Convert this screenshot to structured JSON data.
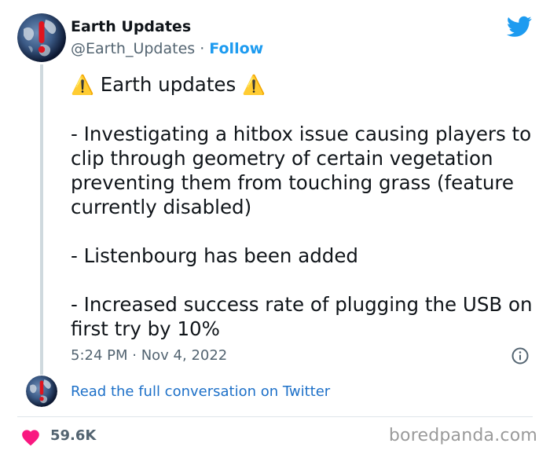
{
  "author": {
    "name": "Earth Updates",
    "handle": "@Earth_Updates",
    "separator": " · ",
    "follow_label": "Follow"
  },
  "tweet": {
    "warning_emoji": "⚠️",
    "heading": "Earth updates",
    "lines": [
      "- Investigating a hitbox issue causing players to clip through geometry of certain vegetation preventing them from touching grass (feature currently disabled)",
      "- Listenbourg has been added",
      "- Increased success rate of plugging the USB on first try by 10%"
    ],
    "timestamp": "5:24 PM · Nov 4, 2022"
  },
  "conversation_link": "Read the full conversation on Twitter",
  "footer": {
    "like_count": "59.6K",
    "watermark": "boredpanda.com"
  },
  "colors": {
    "follow_blue": "#1d9bf0",
    "link_blue": "#1d70c8",
    "heart_pink": "#f91880",
    "muted_text": "#536471",
    "thread_line": "#cfd9de"
  },
  "icons": {
    "brand": "twitter-bird-icon",
    "info": "info-icon",
    "like": "heart-icon"
  }
}
